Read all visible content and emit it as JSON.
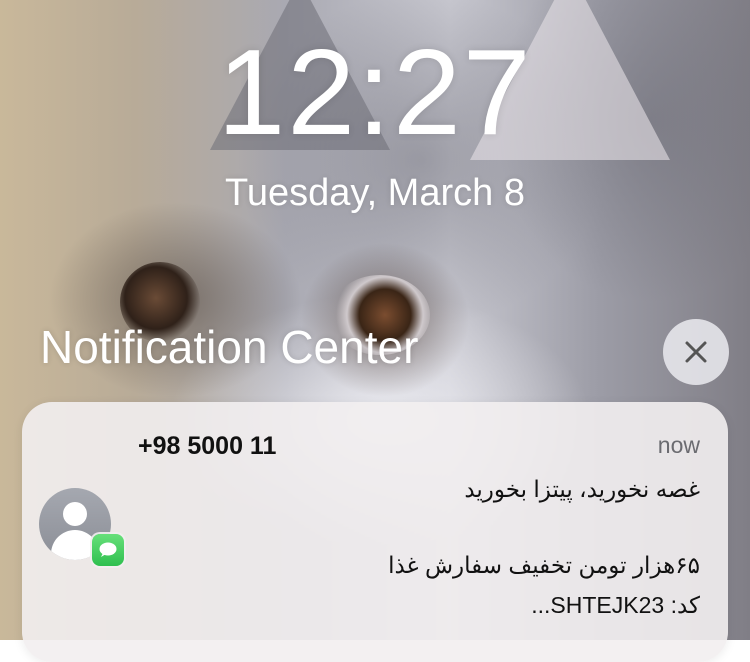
{
  "lockscreen": {
    "time": "12:27",
    "date": "Tuesday, March 8",
    "title": "Notification Center"
  },
  "notification": {
    "sender": "+98 5000 11",
    "time_label": "now",
    "lines": [
      "غصه نخورید، پیتزا بخورید",
      "۶۵هزار تومن تخفیف سفارش غذا",
      "کد: SHTEJK23..."
    ],
    "app_icon": "messages-icon",
    "avatar_icon": "person-icon"
  },
  "icons": {
    "close": "close-icon"
  },
  "colors": {
    "text": "#ffffff",
    "notification_bg": "#f2eef0",
    "message_green": "#2fbf4f"
  }
}
